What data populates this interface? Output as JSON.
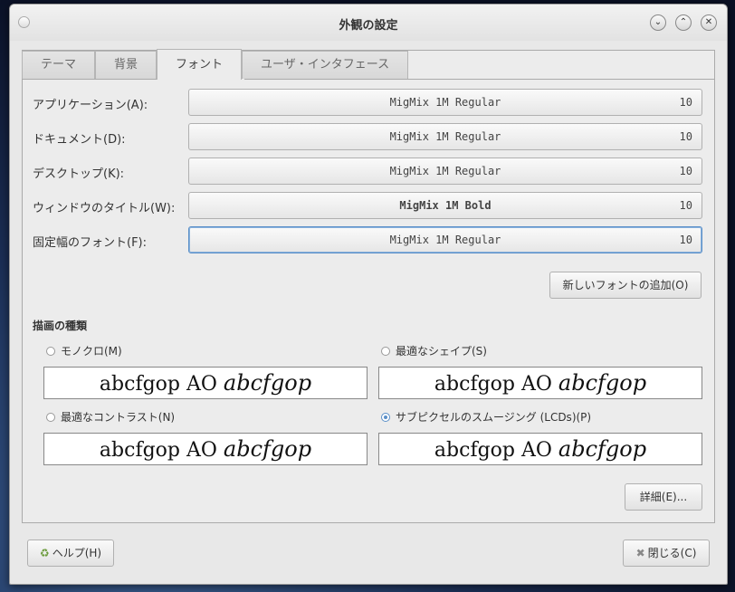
{
  "window": {
    "title": "外観の設定",
    "buttons": [
      "⌄",
      "⌃",
      "✕"
    ]
  },
  "tabs": [
    {
      "label": "テーマ",
      "active": false
    },
    {
      "label": "背景",
      "active": false
    },
    {
      "label": "フォント",
      "active": true
    },
    {
      "label": "ユーザ・インタフェース",
      "active": false
    }
  ],
  "fonts": [
    {
      "label": "アプリケーション(A):",
      "font": "MigMix 1M Regular",
      "size": "10"
    },
    {
      "label": "ドキュメント(D):",
      "font": "MigMix 1M Regular",
      "size": "10"
    },
    {
      "label": "デスクトップ(K):",
      "font": "MigMix 1M Regular",
      "size": "10"
    },
    {
      "label": "ウィンドウのタイトル(W):",
      "font": "MigMix 1M Bold",
      "size": "10"
    },
    {
      "label": "固定幅のフォント(F):",
      "font": "MigMix 1M Regular",
      "size": "10"
    }
  ],
  "add_font_button": "新しいフォントの追加(O)",
  "rendering": {
    "title": "描画の種類",
    "options": [
      {
        "label": "モノクロ(M)",
        "selected": false
      },
      {
        "label": "最適なシェイプ(S)",
        "selected": false
      },
      {
        "label": "最適なコントラスト(N)",
        "selected": false
      },
      {
        "label": "サブピクセルのスムージング (LCDs)(P)",
        "selected": true
      }
    ],
    "sample_regular": "abcfgop AO ",
    "sample_italic": "abcfgop"
  },
  "details_button": "詳細(E)...",
  "help_button": "ヘルプ(H)",
  "close_button": "閉じる(C)",
  "icons": {
    "help": "help-lifebuoy-icon",
    "close": "close-x-icon"
  }
}
